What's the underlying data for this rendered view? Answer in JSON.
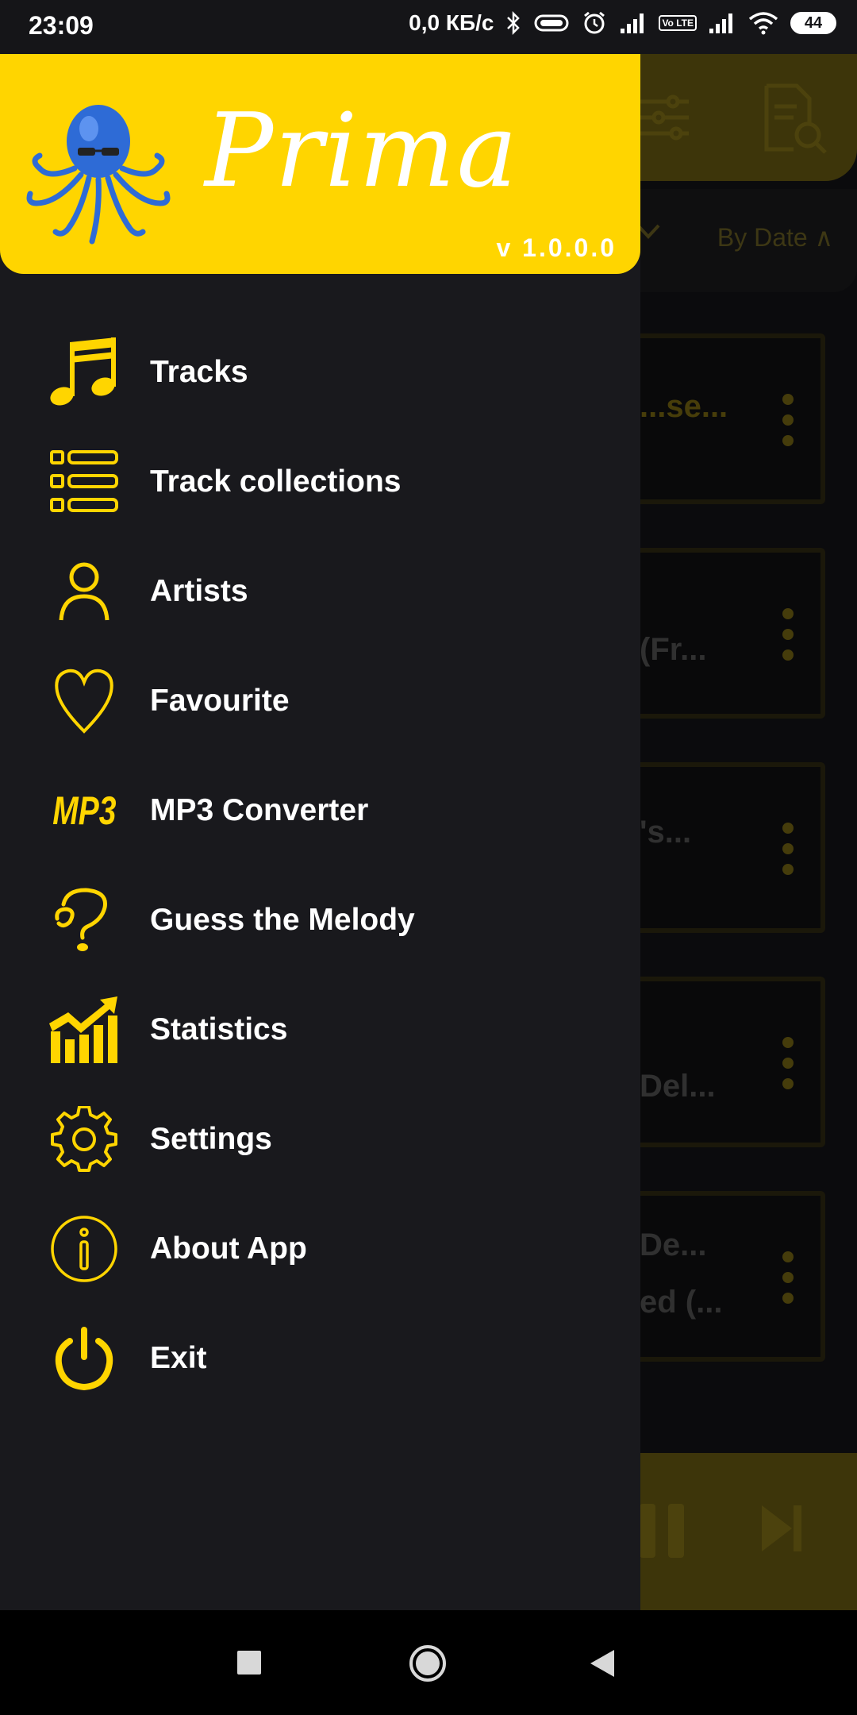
{
  "status_bar": {
    "time": "23:09",
    "speed": "0,0 КБ/с",
    "lte": "Vo LTE",
    "battery": "44"
  },
  "background_app": {
    "sort_label": "By Date ∧",
    "cards": [
      {
        "title": "...se..."
      },
      {
        "title": "(Fr..."
      },
      {
        "title": "'s..."
      },
      {
        "title": "Del..."
      },
      {
        "title": "De...",
        "subtitle": "ed (..."
      }
    ]
  },
  "drawer": {
    "brand": "Prima",
    "version": "v 1.0.0.0",
    "menu": [
      {
        "label": "Tracks",
        "icon": "music-note-icon"
      },
      {
        "label": "Track collections",
        "icon": "list-icon"
      },
      {
        "label": "Artists",
        "icon": "person-icon"
      },
      {
        "label": "Favourite",
        "icon": "heart-icon"
      },
      {
        "label": "MP3 Converter",
        "icon": "mp3-icon"
      },
      {
        "label": "Guess the Melody",
        "icon": "question-note-icon"
      },
      {
        "label": "Statistics",
        "icon": "chart-icon"
      },
      {
        "label": "Settings",
        "icon": "gear-icon"
      },
      {
        "label": "About App",
        "icon": "info-icon"
      },
      {
        "label": "Exit",
        "icon": "power-icon"
      }
    ],
    "mp3_icon_text": "MP3"
  },
  "colors": {
    "accent": "#ffd500",
    "drawer_bg": "#19191d",
    "text": "#ffffff"
  }
}
